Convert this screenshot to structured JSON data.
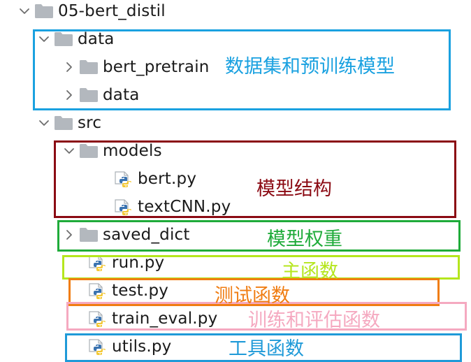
{
  "tree": {
    "root_label": "05-bert_distil",
    "data_folder_label": "data",
    "bert_pretrain_label": "bert_pretrain",
    "data_subfolder_label": "data",
    "src_label": "src",
    "models_label": "models",
    "bert_py_label": "bert.py",
    "textcnn_py_label": "textCNN.py",
    "saved_dict_label": "saved_dict",
    "run_py_label": "run.py",
    "test_py_label": "test.py",
    "train_eval_py_label": "train_eval.py",
    "utils_py_label": "utils.py"
  },
  "annotations": {
    "dataset": "数据集和预训练模型",
    "model_structure": "模型结构",
    "model_weights": "模型权重",
    "main_function": "主函数",
    "test_function": "测试函数",
    "train_eval_function": "训练和评估函数",
    "utility_functions": "工具函数"
  },
  "colors": {
    "dataset": "#1aa1e0",
    "model_structure": "#8b0a13",
    "model_weights": "#1fab3a",
    "main_function": "#b5e61d",
    "test_function": "#f07d12",
    "train_eval_function": "#f5a9c0",
    "utility_functions": "#1f9ad8",
    "folder": "#b3b8be",
    "chevron": "#6e6e6e"
  }
}
